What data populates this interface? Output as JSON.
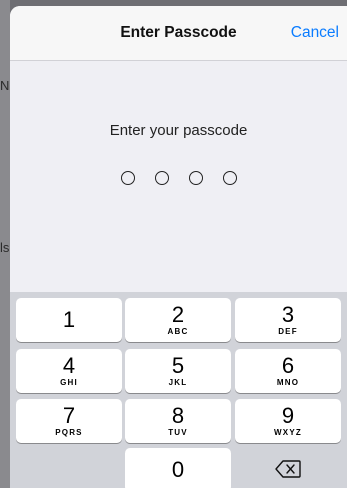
{
  "background": {
    "glyph_top": "N",
    "glyph_bottom": "ls"
  },
  "navbar": {
    "title": "Enter Passcode",
    "cancel_label": "Cancel"
  },
  "prompt": {
    "text": "Enter your passcode",
    "digits_total": 4,
    "digits_entered": 0
  },
  "keypad": {
    "keys": [
      {
        "num": "1",
        "letters": ""
      },
      {
        "num": "2",
        "letters": "ABC"
      },
      {
        "num": "3",
        "letters": "DEF"
      },
      {
        "num": "4",
        "letters": "GHI"
      },
      {
        "num": "5",
        "letters": "JKL"
      },
      {
        "num": "6",
        "letters": "MNO"
      },
      {
        "num": "7",
        "letters": "PQRS"
      },
      {
        "num": "8",
        "letters": "TUV"
      },
      {
        "num": "9",
        "letters": "WXYZ"
      },
      {
        "num": "0",
        "letters": ""
      }
    ],
    "delete_icon": "backspace-icon"
  },
  "colors": {
    "accent": "#0a7cff",
    "keypad_bg": "#d1d3d9",
    "sheet_bg": "#efeff4"
  }
}
